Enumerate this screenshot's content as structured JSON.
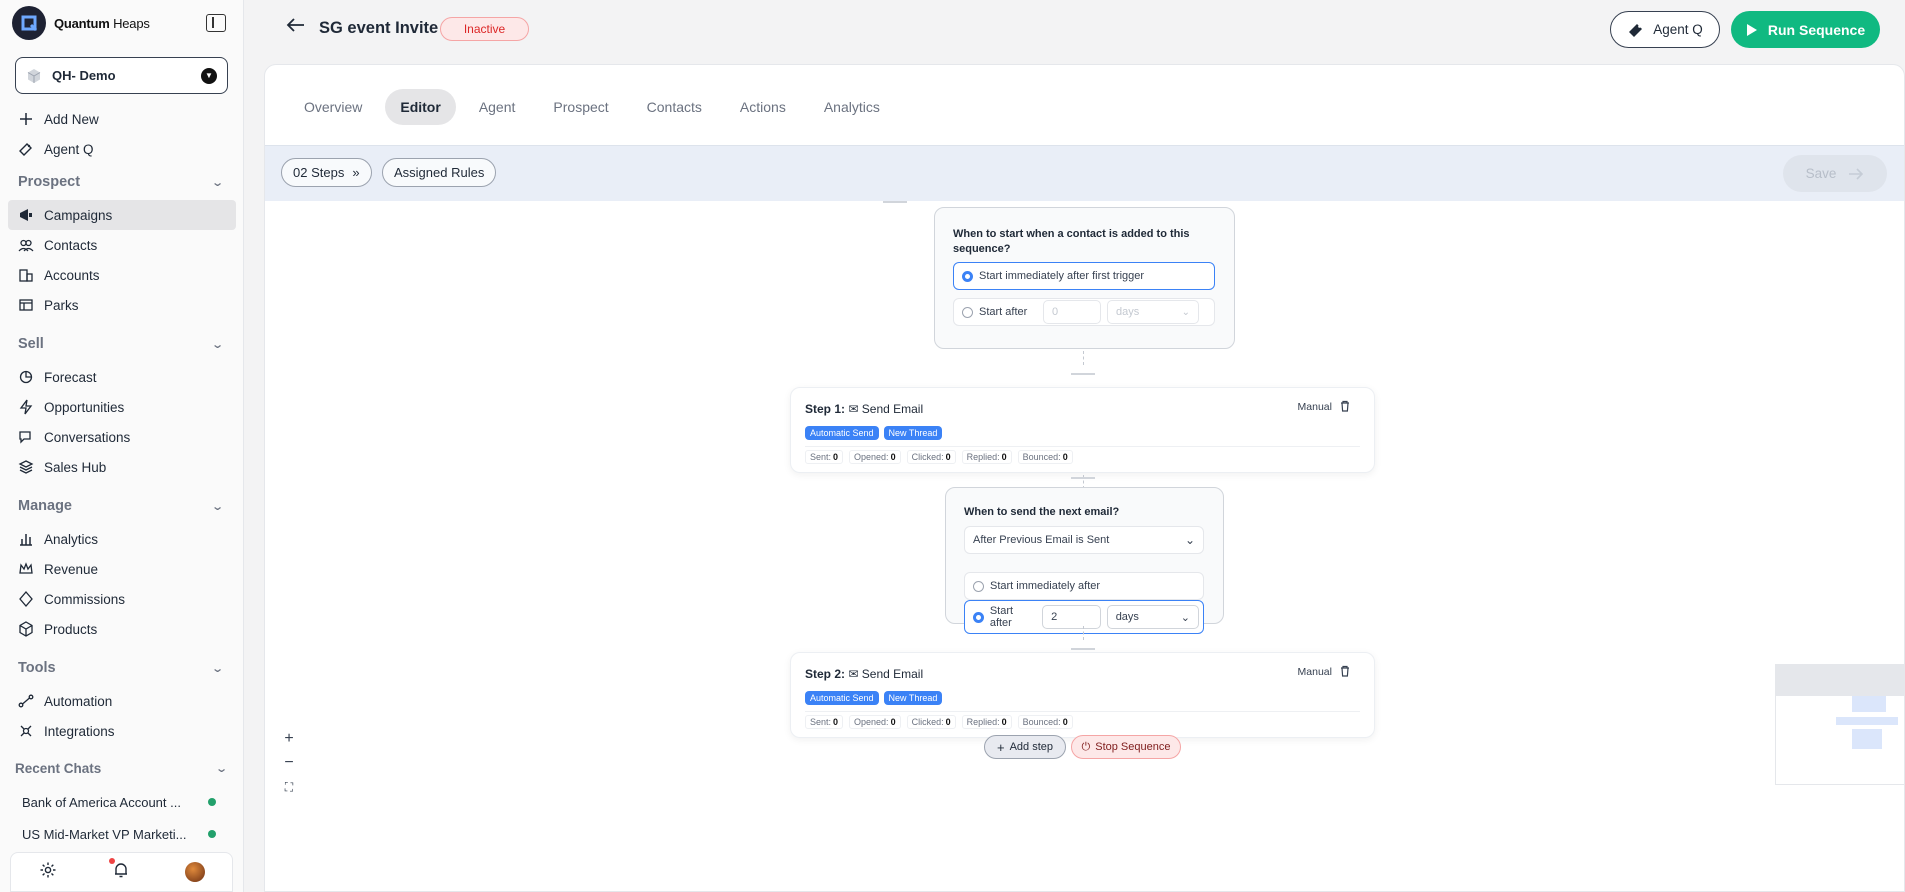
{
  "app": {
    "brand_bold": "Quantum",
    "brand_light": "Heaps",
    "workspace": "QH- Demo"
  },
  "sidebar": {
    "quick": [
      {
        "label": "Add New",
        "icon": "plus-icon"
      },
      {
        "label": "Agent Q",
        "icon": "agent-icon"
      }
    ],
    "sections": {
      "prospect": "Prospect",
      "sell": "Sell",
      "manage": "Manage",
      "tools": "Tools",
      "recent": "Recent Chats"
    },
    "prospect_items": [
      "Campaigns",
      "Contacts",
      "Accounts",
      "Parks"
    ],
    "sell_items": [
      "Forecast",
      "Opportunities",
      "Conversations",
      "Sales Hub"
    ],
    "manage_items": [
      "Analytics",
      "Revenue",
      "Commissions",
      "Products"
    ],
    "tools_items": [
      "Automation",
      "Integrations"
    ],
    "recent_chats": [
      "Bank of America Account ...",
      "US Mid-Market VP Marketi..."
    ],
    "active_item": "Campaigns"
  },
  "header": {
    "title": "SG event Invite",
    "status": "Inactive",
    "agent_button": "Agent Q",
    "run_button": "Run Sequence"
  },
  "tabs": [
    "Overview",
    "Editor",
    "Agent",
    "Prospect",
    "Contacts",
    "Actions",
    "Analytics"
  ],
  "active_tab": "Editor",
  "toolbar": {
    "steps_label": "02 Steps",
    "rules_label": "Assigned Rules",
    "save_label": "Save"
  },
  "trigger_card": {
    "question": "When to start when a contact is added to this sequence?",
    "option_immediate": "Start immediately after first trigger",
    "option_after": "Start after",
    "after_value": "0",
    "after_unit": "days",
    "selected": "immediate"
  },
  "steps": [
    {
      "label": "Step 1:",
      "name": "Send Email",
      "mode": "Manual",
      "tags": [
        "Automatic Send",
        "New Thread"
      ],
      "stats": [
        {
          "label": "Sent:",
          "value": "0"
        },
        {
          "label": "Opened:",
          "value": "0"
        },
        {
          "label": "Clicked:",
          "value": "0"
        },
        {
          "label": "Replied:",
          "value": "0"
        },
        {
          "label": "Bounced:",
          "value": "0"
        }
      ]
    },
    {
      "label": "Step 2:",
      "name": "Send Email",
      "mode": "Manual",
      "tags": [
        "Automatic Send",
        "New Thread"
      ],
      "stats": [
        {
          "label": "Sent:",
          "value": "0"
        },
        {
          "label": "Opened:",
          "value": "0"
        },
        {
          "label": "Clicked:",
          "value": "0"
        },
        {
          "label": "Replied:",
          "value": "0"
        },
        {
          "label": "Bounced:",
          "value": "0"
        }
      ]
    }
  ],
  "delay_card": {
    "question": "When to send the next email?",
    "dropdown_value": "After Previous Email is Sent",
    "option_immediate": "Start immediately after",
    "option_after": "Start after",
    "after_value": "2",
    "after_unit": "days",
    "selected": "after"
  },
  "actions": {
    "add_step": "Add step",
    "stop_sequence": "Stop Sequence"
  },
  "colors": {
    "accent": "#10b981",
    "primary_blue": "#3b82f6",
    "danger": "#dc2626"
  }
}
